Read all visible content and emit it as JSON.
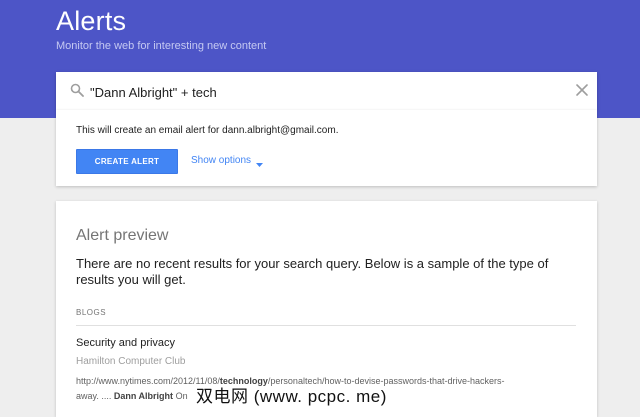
{
  "header": {
    "title": "Alerts",
    "subtitle": "Monitor the web for interesting new content",
    "bg_color": "#4d55c7"
  },
  "search": {
    "value": "\"Dann Albright\" + tech",
    "search_icon": "search-icon",
    "clear_icon": "close-icon"
  },
  "options": {
    "info": "This will create an email alert for dann.albright@gmail.com.",
    "create_label": "CREATE ALERT",
    "show_options_label": "Show options",
    "accent_color": "#4285f4"
  },
  "preview": {
    "title": "Alert preview",
    "message": "There are no recent results for your search query. Below is a sample of the type of results you will get.",
    "section_label": "BLOGS",
    "result": {
      "title": "Security and privacy",
      "source": "Hamilton Computer Club",
      "url_prefix": "http://www.nytimes.com/2012/11/08/",
      "url_bold": "technology",
      "url_suffix": "/personaltech/how-to-devise-passwords-that-drive-hackers-",
      "snippet_prefix": "away. ....",
      "snippet_bold": "Dann Albright",
      "snippet_suffix": "On"
    }
  },
  "watermark": "双电网 (www. pcpc. me)"
}
